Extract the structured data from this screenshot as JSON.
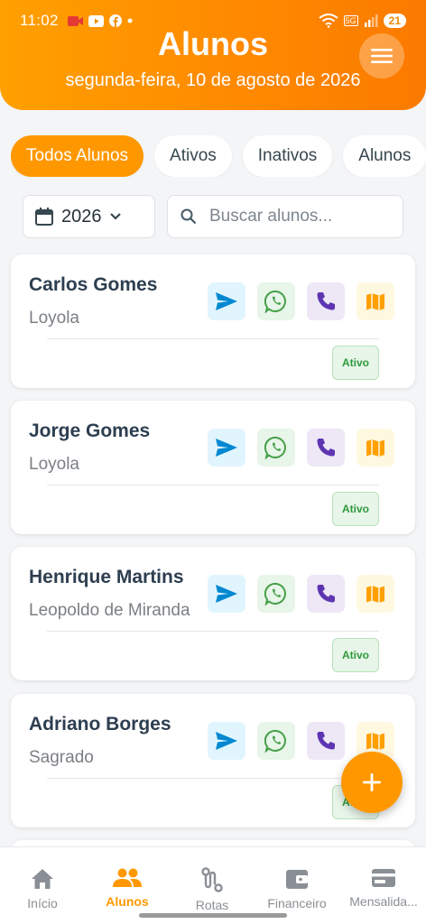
{
  "status_bar": {
    "time": "11:02",
    "network": "5G",
    "battery": "21"
  },
  "header": {
    "title": "Alunos",
    "date": "segunda-feira, 10 de agosto de 2026"
  },
  "filters": [
    {
      "label": "Todos Alunos",
      "active": true
    },
    {
      "label": "Ativos",
      "active": false
    },
    {
      "label": "Inativos",
      "active": false
    },
    {
      "label": "Alunos",
      "active": false
    }
  ],
  "year_select": {
    "value": "2026"
  },
  "search": {
    "placeholder": "Buscar alunos..."
  },
  "students": [
    {
      "name": "Carlos Gomes",
      "school": "Loyola",
      "status": "Ativo"
    },
    {
      "name": "Jorge Gomes",
      "school": "Loyola",
      "status": "Ativo"
    },
    {
      "name": "Henrique Martins",
      "school": "Leopoldo de Miranda",
      "status": "Ativo"
    },
    {
      "name": "Adriano Borges",
      "school": "Sagrado",
      "status": "Ativo"
    }
  ],
  "nav": [
    {
      "label": "Início",
      "icon": "home-icon",
      "active": false
    },
    {
      "label": "Alunos",
      "icon": "people-icon",
      "active": true
    },
    {
      "label": "Rotas",
      "icon": "route-icon",
      "active": false
    },
    {
      "label": "Financeiro",
      "icon": "wallet-icon",
      "active": false
    },
    {
      "label": "Mensalida...",
      "icon": "credit-card-icon",
      "active": false
    }
  ],
  "colors": {
    "accent": "#ff9800",
    "telegram": "#0288d1",
    "whatsapp": "#43a047",
    "phone": "#5e35b1",
    "map": "#ffa000",
    "status_active": "#2e9a3b"
  }
}
